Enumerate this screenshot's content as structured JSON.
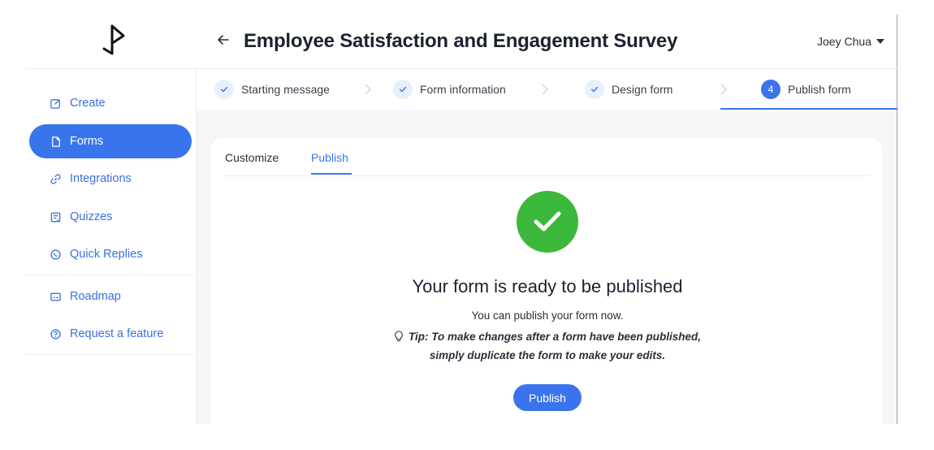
{
  "header": {
    "title": "Employee Satisfaction and Engagement Survey",
    "user_name": "Joey Chua"
  },
  "sidebar": {
    "items": [
      {
        "label": "Create",
        "icon": "edit-icon",
        "active": false
      },
      {
        "label": "Forms",
        "icon": "document-icon",
        "active": true
      },
      {
        "label": "Integrations",
        "icon": "link-icon",
        "active": false
      },
      {
        "label": "Quizzes",
        "icon": "quiz-icon",
        "active": false
      },
      {
        "label": "Quick Replies",
        "icon": "whatsapp-icon",
        "active": false
      },
      {
        "label": "Roadmap",
        "icon": "roadmap-icon",
        "active": false
      },
      {
        "label": "Request a feature",
        "icon": "help-circle-icon",
        "active": false
      }
    ]
  },
  "stepper": {
    "steps": [
      {
        "label": "Starting message",
        "status": "done"
      },
      {
        "label": "Form information",
        "status": "done"
      },
      {
        "label": "Design form",
        "status": "done"
      },
      {
        "label": "Publish form",
        "status": "current",
        "number": "4"
      }
    ]
  },
  "tabs": {
    "customize": "Customize",
    "publish": "Publish"
  },
  "main": {
    "heading": "Your form is ready to be published",
    "subtext": "You can publish your form now.",
    "tip_line1": "Tip: To make changes after a form have been published,",
    "tip_line2": "simply duplicate the form to make your edits.",
    "publish_button": "Publish"
  },
  "colors": {
    "accent": "#3a74ec",
    "success": "#3cb83a",
    "check_bg": "#e8effd"
  }
}
